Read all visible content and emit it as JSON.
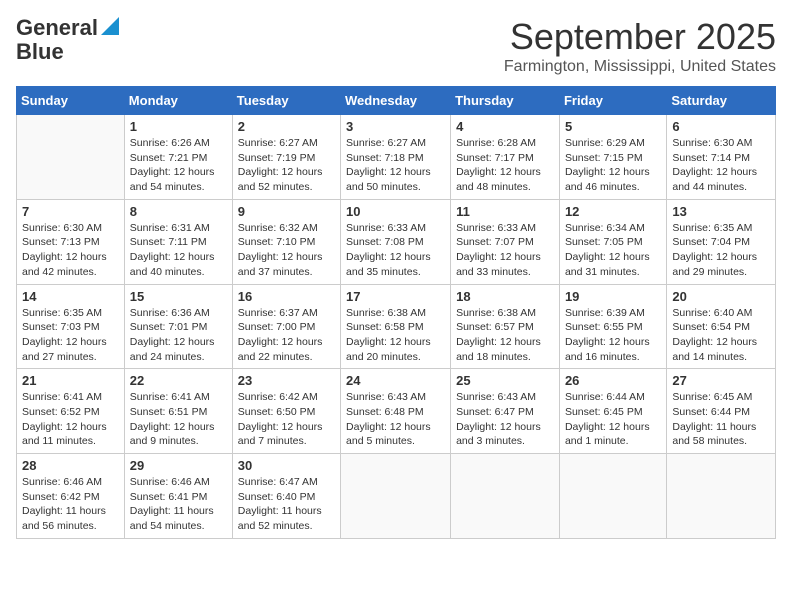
{
  "header": {
    "logo_line1": "General",
    "logo_line2": "Blue",
    "month": "September 2025",
    "location": "Farmington, Mississippi, United States"
  },
  "days_of_week": [
    "Sunday",
    "Monday",
    "Tuesday",
    "Wednesday",
    "Thursday",
    "Friday",
    "Saturday"
  ],
  "weeks": [
    [
      {
        "day": "",
        "info": ""
      },
      {
        "day": "1",
        "info": "Sunrise: 6:26 AM\nSunset: 7:21 PM\nDaylight: 12 hours and 54 minutes."
      },
      {
        "day": "2",
        "info": "Sunrise: 6:27 AM\nSunset: 7:19 PM\nDaylight: 12 hours and 52 minutes."
      },
      {
        "day": "3",
        "info": "Sunrise: 6:27 AM\nSunset: 7:18 PM\nDaylight: 12 hours and 50 minutes."
      },
      {
        "day": "4",
        "info": "Sunrise: 6:28 AM\nSunset: 7:17 PM\nDaylight: 12 hours and 48 minutes."
      },
      {
        "day": "5",
        "info": "Sunrise: 6:29 AM\nSunset: 7:15 PM\nDaylight: 12 hours and 46 minutes."
      },
      {
        "day": "6",
        "info": "Sunrise: 6:30 AM\nSunset: 7:14 PM\nDaylight: 12 hours and 44 minutes."
      }
    ],
    [
      {
        "day": "7",
        "info": "Sunrise: 6:30 AM\nSunset: 7:13 PM\nDaylight: 12 hours and 42 minutes."
      },
      {
        "day": "8",
        "info": "Sunrise: 6:31 AM\nSunset: 7:11 PM\nDaylight: 12 hours and 40 minutes."
      },
      {
        "day": "9",
        "info": "Sunrise: 6:32 AM\nSunset: 7:10 PM\nDaylight: 12 hours and 37 minutes."
      },
      {
        "day": "10",
        "info": "Sunrise: 6:33 AM\nSunset: 7:08 PM\nDaylight: 12 hours and 35 minutes."
      },
      {
        "day": "11",
        "info": "Sunrise: 6:33 AM\nSunset: 7:07 PM\nDaylight: 12 hours and 33 minutes."
      },
      {
        "day": "12",
        "info": "Sunrise: 6:34 AM\nSunset: 7:05 PM\nDaylight: 12 hours and 31 minutes."
      },
      {
        "day": "13",
        "info": "Sunrise: 6:35 AM\nSunset: 7:04 PM\nDaylight: 12 hours and 29 minutes."
      }
    ],
    [
      {
        "day": "14",
        "info": "Sunrise: 6:35 AM\nSunset: 7:03 PM\nDaylight: 12 hours and 27 minutes."
      },
      {
        "day": "15",
        "info": "Sunrise: 6:36 AM\nSunset: 7:01 PM\nDaylight: 12 hours and 24 minutes."
      },
      {
        "day": "16",
        "info": "Sunrise: 6:37 AM\nSunset: 7:00 PM\nDaylight: 12 hours and 22 minutes."
      },
      {
        "day": "17",
        "info": "Sunrise: 6:38 AM\nSunset: 6:58 PM\nDaylight: 12 hours and 20 minutes."
      },
      {
        "day": "18",
        "info": "Sunrise: 6:38 AM\nSunset: 6:57 PM\nDaylight: 12 hours and 18 minutes."
      },
      {
        "day": "19",
        "info": "Sunrise: 6:39 AM\nSunset: 6:55 PM\nDaylight: 12 hours and 16 minutes."
      },
      {
        "day": "20",
        "info": "Sunrise: 6:40 AM\nSunset: 6:54 PM\nDaylight: 12 hours and 14 minutes."
      }
    ],
    [
      {
        "day": "21",
        "info": "Sunrise: 6:41 AM\nSunset: 6:52 PM\nDaylight: 12 hours and 11 minutes."
      },
      {
        "day": "22",
        "info": "Sunrise: 6:41 AM\nSunset: 6:51 PM\nDaylight: 12 hours and 9 minutes."
      },
      {
        "day": "23",
        "info": "Sunrise: 6:42 AM\nSunset: 6:50 PM\nDaylight: 12 hours and 7 minutes."
      },
      {
        "day": "24",
        "info": "Sunrise: 6:43 AM\nSunset: 6:48 PM\nDaylight: 12 hours and 5 minutes."
      },
      {
        "day": "25",
        "info": "Sunrise: 6:43 AM\nSunset: 6:47 PM\nDaylight: 12 hours and 3 minutes."
      },
      {
        "day": "26",
        "info": "Sunrise: 6:44 AM\nSunset: 6:45 PM\nDaylight: 12 hours and 1 minute."
      },
      {
        "day": "27",
        "info": "Sunrise: 6:45 AM\nSunset: 6:44 PM\nDaylight: 11 hours and 58 minutes."
      }
    ],
    [
      {
        "day": "28",
        "info": "Sunrise: 6:46 AM\nSunset: 6:42 PM\nDaylight: 11 hours and 56 minutes."
      },
      {
        "day": "29",
        "info": "Sunrise: 6:46 AM\nSunset: 6:41 PM\nDaylight: 11 hours and 54 minutes."
      },
      {
        "day": "30",
        "info": "Sunrise: 6:47 AM\nSunset: 6:40 PM\nDaylight: 11 hours and 52 minutes."
      },
      {
        "day": "",
        "info": ""
      },
      {
        "day": "",
        "info": ""
      },
      {
        "day": "",
        "info": ""
      },
      {
        "day": "",
        "info": ""
      }
    ]
  ]
}
